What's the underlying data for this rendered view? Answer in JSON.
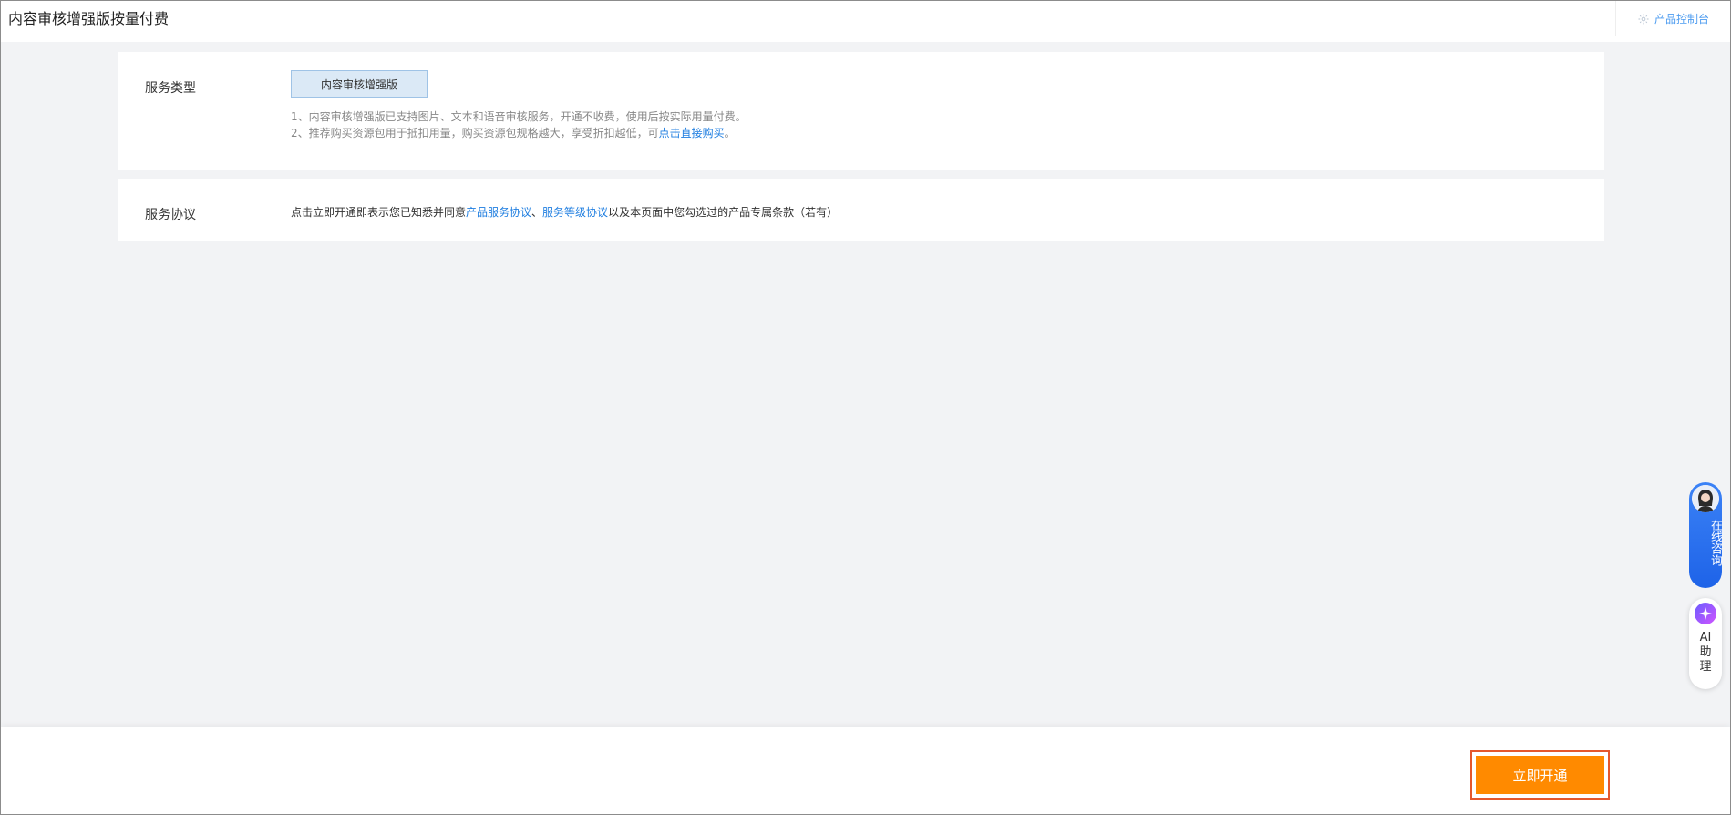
{
  "header": {
    "title": "内容审核增强版按量付费",
    "console_link": "产品控制台"
  },
  "service_type": {
    "label": "服务类型",
    "option": "内容审核增强版",
    "note1": "1、内容审核增强版已支持图片、文本和语音审核服务，开通不收费，使用后按实际用量付费。",
    "note2_prefix": "2、推荐购买资源包用于抵扣用量，购买资源包规格越大，享受折扣越低，可",
    "note2_link": "点击直接购买",
    "note2_suffix": "。"
  },
  "agreement": {
    "label": "服务协议",
    "text_prefix": "点击立即开通即表示您已知悉并同意",
    "link1": "产品服务协议",
    "separator": "、",
    "link2": "服务等级协议",
    "text_suffix": "以及本页面中您勾选过的产品专属条款（若有）"
  },
  "footer": {
    "open_button": "立即开通"
  },
  "floating": {
    "consult_label": "在线咨询",
    "ai_label_line1": "AI",
    "ai_label_line2": "助",
    "ai_label_line3": "理"
  },
  "colors": {
    "accent": "#ff8a00",
    "link": "#1f7ee0",
    "consult": "#1e63e8"
  }
}
